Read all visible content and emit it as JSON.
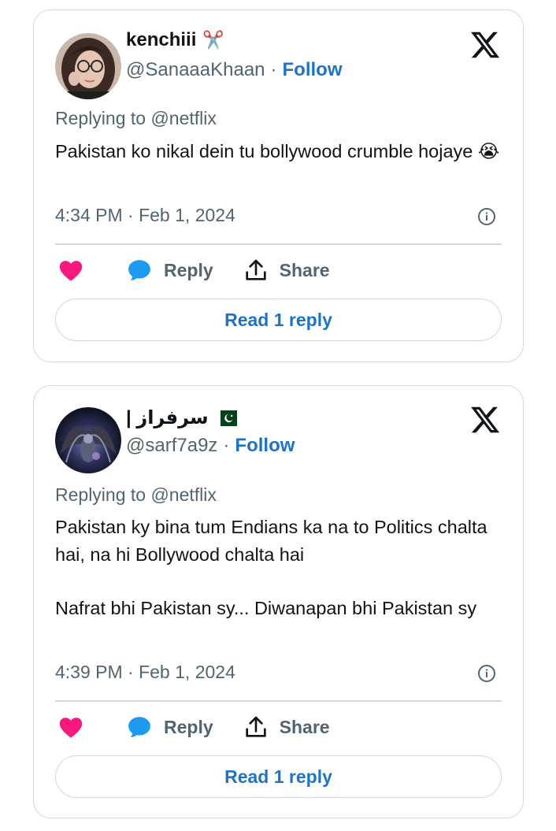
{
  "tweets": [
    {
      "display_name": "kenchiii",
      "name_emoji": "✂️",
      "handle": "@SanaaaKhaan",
      "follow_label": "Follow",
      "replying_to": "Replying to @netflix",
      "paragraphs": [
        "Pakistan ko nikal dein tu bollywood crumble hojaye 😭"
      ],
      "timestamp": "4:34 PM · Feb 1, 2024",
      "reply_label": "Reply",
      "share_label": "Share",
      "read_replies_label": "Read 1 reply"
    },
    {
      "display_name": "سرفراز |",
      "name_emoji": "pakistan-flag",
      "handle": "@sarf7a9z",
      "follow_label": "Follow",
      "replying_to": "Replying to @netflix",
      "paragraphs": [
        "Pakistan ky bina tum Endians ka na to Politics chalta hai, na hi Bollywood chalta hai",
        "Nafrat bhi Pakistan sy... Diwanapan bhi Pakistan sy"
      ],
      "timestamp": "4:39 PM · Feb 1, 2024",
      "reply_label": "Reply",
      "share_label": "Share",
      "read_replies_label": "Read 1 reply"
    }
  ],
  "separator": "·",
  "colors": {
    "like_heart": "#f91880",
    "reply_bubble": "#1d9bf0",
    "follow_link": "#1d74c4",
    "secondary_text": "#536471",
    "border": "#cfd9de"
  },
  "icons": [
    "x-logo-icon",
    "heart-icon",
    "reply-bubble-icon",
    "share-icon",
    "info-icon"
  ]
}
